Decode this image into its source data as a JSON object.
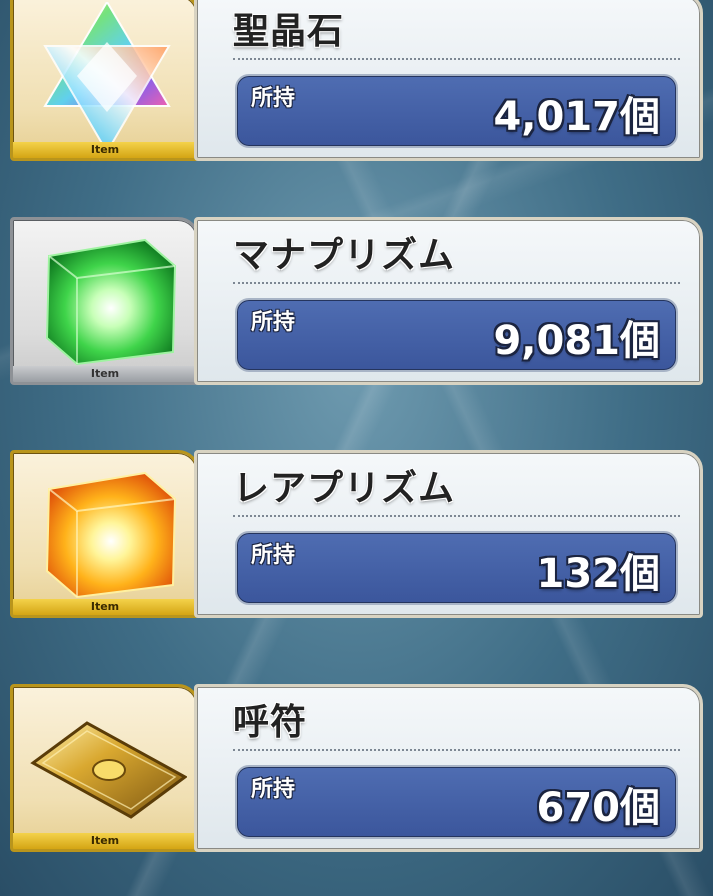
{
  "items": [
    {
      "name": "聖晶石",
      "owned_label": "所持",
      "count": "4,017個",
      "tag": "Item",
      "frame": "gold",
      "icon": "saint-quartz-icon"
    },
    {
      "name": "マナプリズム",
      "owned_label": "所持",
      "count": "9,081個",
      "tag": "Item",
      "frame": "silver",
      "icon": "mana-prism-icon"
    },
    {
      "name": "レアプリズム",
      "owned_label": "所持",
      "count": "132個",
      "tag": "Item",
      "frame": "gold",
      "icon": "rare-prism-icon"
    },
    {
      "name": "呼符",
      "owned_label": "所持",
      "count": "670個",
      "tag": "Item",
      "frame": "gold",
      "icon": "summon-ticket-icon"
    }
  ]
}
